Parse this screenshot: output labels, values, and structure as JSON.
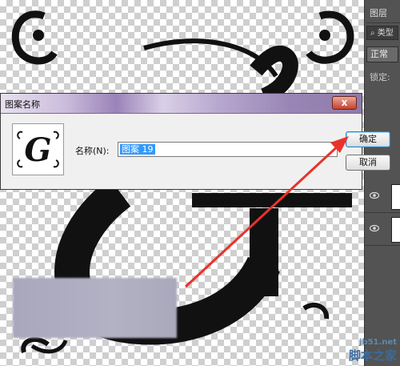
{
  "canvas": {
    "glyph": "G"
  },
  "layers_panel": {
    "tab_label": "图层",
    "search_label": "类型",
    "blend_mode": "正常",
    "lock_label": "锁定:"
  },
  "dialog": {
    "title": "图案名称",
    "close_symbol": "x",
    "preview_glyph": "G",
    "name_label": "名称(N):",
    "name_value": "图案 19",
    "ok_label": "确定",
    "cancel_label": "取消"
  },
  "watermark": {
    "url": "jb51.net",
    "site": "脚本之家"
  }
}
